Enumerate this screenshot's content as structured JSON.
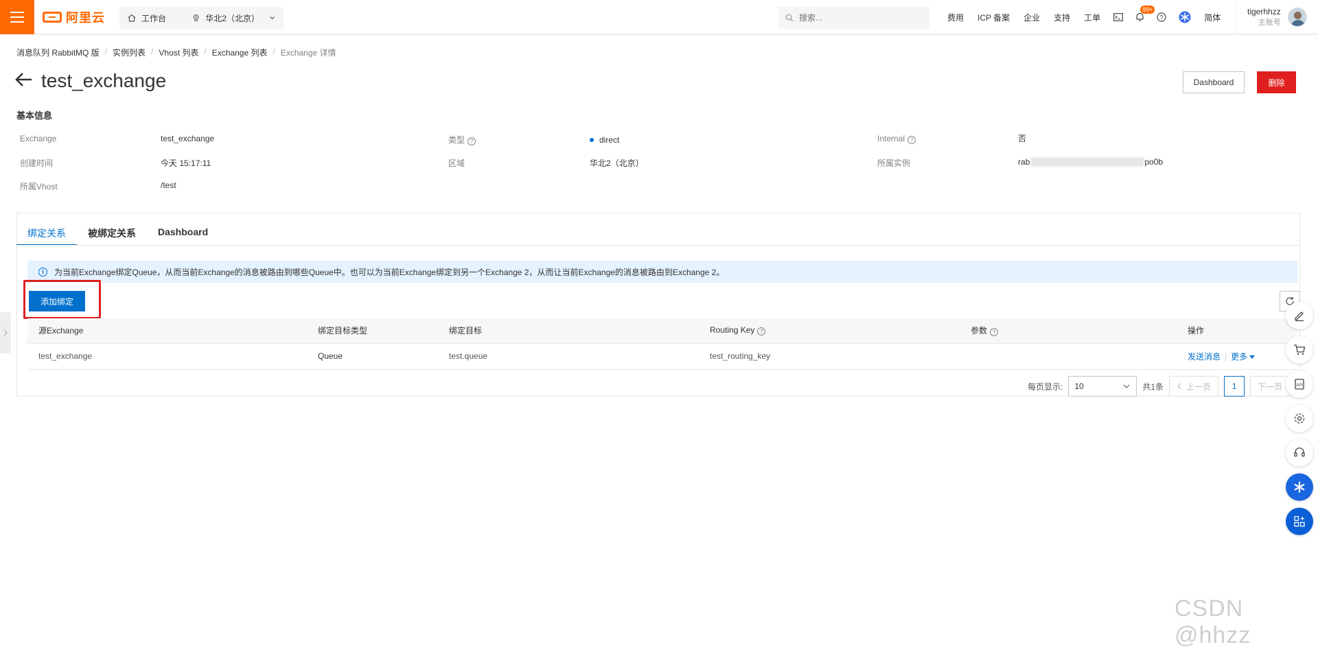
{
  "topbar": {
    "logo_text": "阿里云",
    "workbench_label": "工作台",
    "region_label": "华北2（北京）",
    "search_placeholder": "搜索...",
    "links": [
      "费用",
      "ICP 备案",
      "企业",
      "支持",
      "工单"
    ],
    "notification_badge": "99+",
    "language_label": "简体",
    "user_name": "tigerhhzz",
    "user_role": "主账号",
    "accent_color": "#ff6a00"
  },
  "breadcrumb": [
    "消息队列 RabbitMQ 版",
    "实例列表",
    "Vhost 列表",
    "Exchange 列表",
    "Exchange 详情"
  ],
  "header": {
    "title": "test_exchange",
    "dashboard_button": "Dashboard",
    "delete_button": "删除"
  },
  "basic_info": {
    "section_title": "基本信息",
    "exchange_label": "Exchange",
    "exchange_value": "test_exchange",
    "type_label": "类型",
    "type_value": "direct",
    "internal_label": "Internal",
    "internal_value": "否",
    "created_label": "创建时间",
    "created_value": "今天 15:17:11",
    "region_label": "区域",
    "region_value": "华北2（北京）",
    "instance_label": "所属实例",
    "instance_prefix": "rab",
    "instance_suffix": "po0b",
    "vhost_label": "所属Vhost",
    "vhost_value": "/test"
  },
  "tabs": [
    "绑定关系",
    "被绑定关系",
    "Dashboard"
  ],
  "notice_text": "为当前Exchange绑定Queue，从而当前Exchange的消息被路由到哪些Queue中。也可以为当前Exchange绑定到另一个Exchange 2，从而让当前Exchange的消息被路由到Exchange 2。",
  "add_binding_button": "添加绑定",
  "table": {
    "headers": [
      "源Exchange",
      "绑定目标类型",
      "绑定目标",
      "Routing Key",
      "参数",
      "操作"
    ],
    "rows": [
      {
        "source": "test_exchange",
        "target_type": "Queue",
        "target": "test.queue",
        "routing_key": "test_routing_key",
        "args": "",
        "op_send": "发送消息",
        "op_more": "更多"
      }
    ]
  },
  "pager": {
    "page_size_label": "每页显示:",
    "page_size": "10",
    "total": "共1条",
    "prev": "上一页",
    "current_page": "1",
    "next": "下一页"
  },
  "watermark": "CSDN @hhzz"
}
